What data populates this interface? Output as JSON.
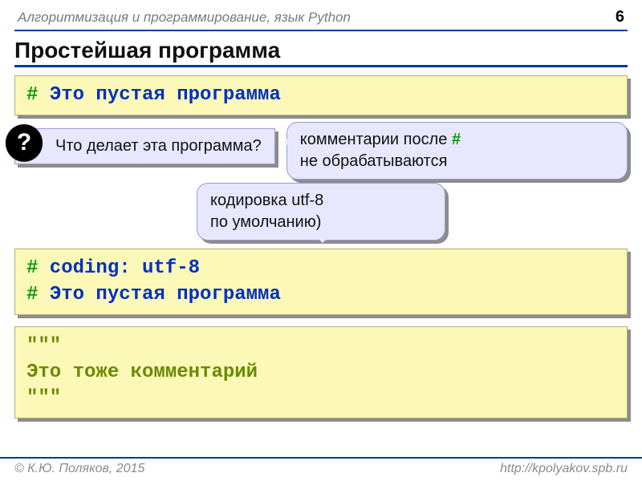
{
  "header": {
    "course": "Алгоритмизация и программирование, язык Python",
    "page": "6"
  },
  "title": "Простейшая программа",
  "code_box_1": {
    "hash": "#",
    "text": " Это пустая программа"
  },
  "question": {
    "badge": "?",
    "text": "Что делает эта программа?"
  },
  "callout_top": {
    "line1_pre": "комментарии после ",
    "line1_hash": "#",
    "line2": "не обрабатываются"
  },
  "callout_mid": {
    "line1": "кодировка utf-8",
    "line2": "по умолчанию)"
  },
  "code_box_2": {
    "l1_hash": "#",
    "l1_text": " coding: utf-8",
    "l2_hash": "#",
    "l2_text": " Это пустая программа"
  },
  "code_box_3": {
    "l1": "\"\"\"",
    "l2": "Это тоже комментарий",
    "l3": "\"\"\""
  },
  "footer": {
    "author": "© К.Ю. Поляков, 2015",
    "url": "http://kpolyakov.spb.ru"
  }
}
